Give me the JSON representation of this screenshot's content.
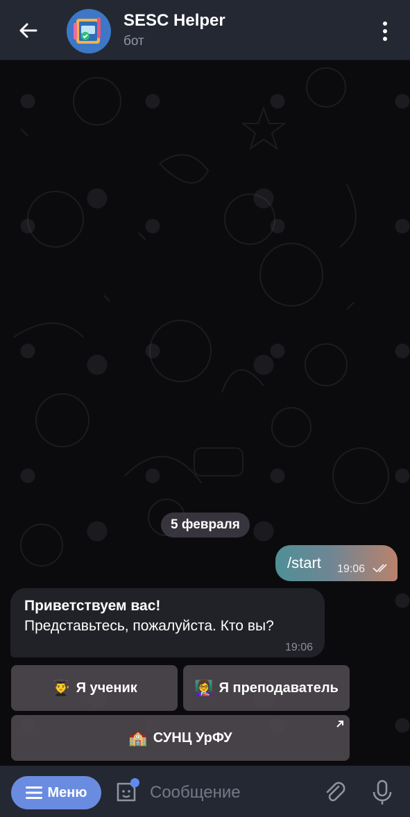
{
  "header": {
    "title": "SESC Helper",
    "subtitle": "бот",
    "back_icon": "arrow-left-icon",
    "more_icon": "more-vertical-icon"
  },
  "chat": {
    "date_chip": "5 февраля",
    "messages": [
      {
        "direction": "out",
        "text": "/start",
        "time": "19:06",
        "status": "read"
      },
      {
        "direction": "in",
        "line1": "Приветствуем вас!",
        "line2": "Представьтесь, пожалуйста. Кто вы?",
        "time": "19:06"
      }
    ]
  },
  "keyboard": {
    "buttons": [
      {
        "emoji": "👨‍🎓",
        "label": "Я ученик"
      },
      {
        "emoji": "👩‍🏫",
        "label": "Я преподаватель"
      },
      {
        "emoji": "🏫",
        "label": "СУНЦ УрФУ",
        "is_link": true
      }
    ]
  },
  "bottom": {
    "menu_label": "Меню",
    "input_placeholder": "Сообщение",
    "icons": [
      "sticker-icon",
      "attach-icon",
      "microphone-icon"
    ]
  },
  "colors": {
    "header_bg": "#242833",
    "menu_button": "#6a8ce0",
    "incoming_bubble": "#212227",
    "outgoing_gradient_start": "#4f8f96",
    "outgoing_gradient_end": "#b9826c"
  }
}
